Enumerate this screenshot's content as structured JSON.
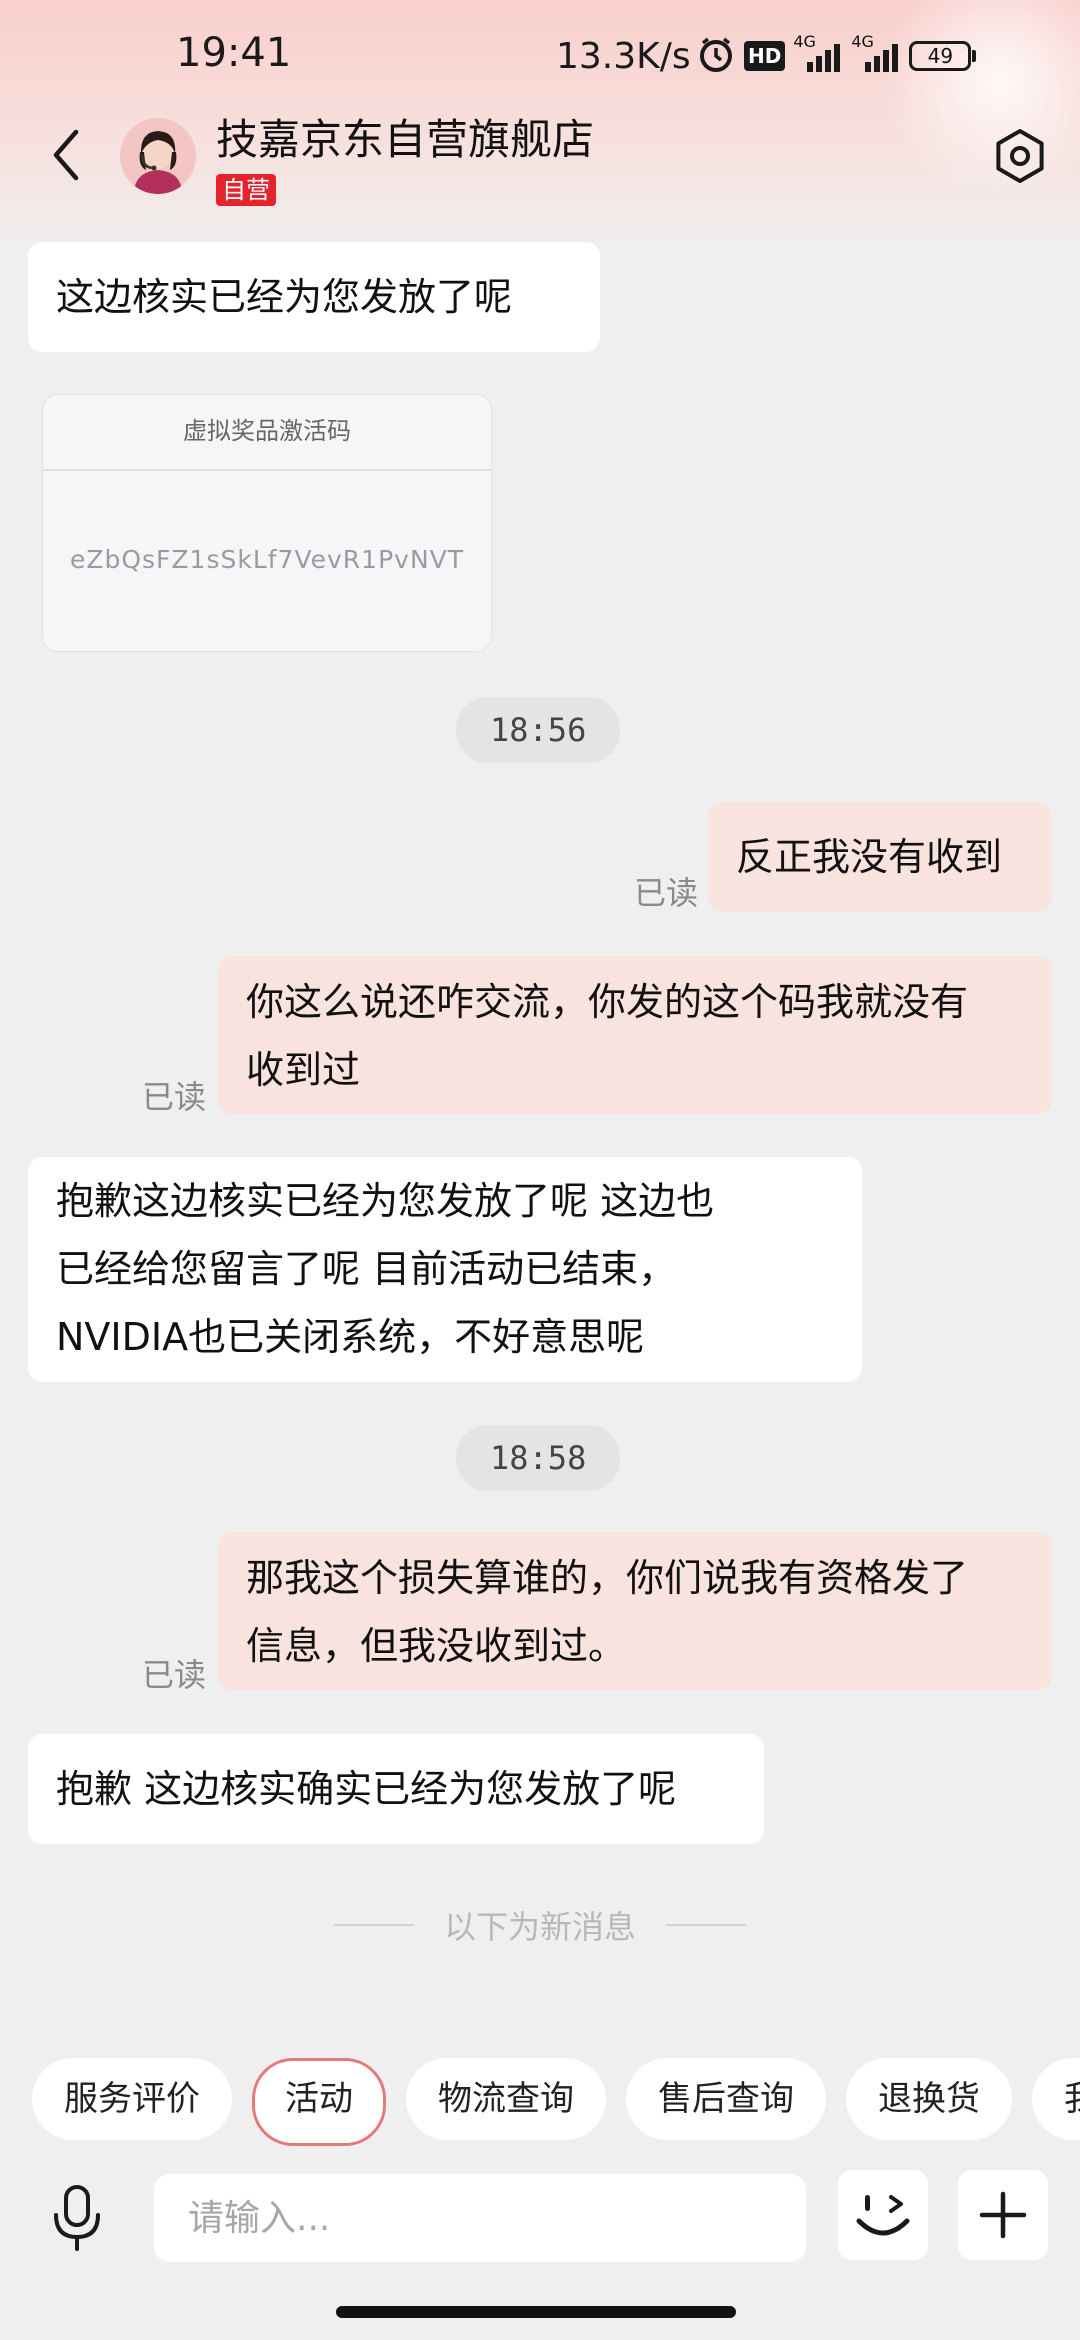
{
  "status_bar": {
    "time": "19:41",
    "net_speed": "13.3K/s",
    "battery": "49",
    "network_a": "4G",
    "network_b": "4G",
    "hd_badge": "HD",
    "icons": [
      "alarm-icon",
      "hd-icon",
      "signal-icon",
      "signal-icon",
      "battery-icon"
    ]
  },
  "header": {
    "store_name": "技嘉京东自营旗舰店",
    "tag": "自营",
    "icons": [
      "back-icon",
      "avatar",
      "settings-icon"
    ]
  },
  "messages": [
    {
      "side": "left",
      "text": "这边核实已经为您发放了呢"
    },
    {
      "side": "left",
      "type": "image",
      "card_title": "虚拟奖品激活码",
      "code": "eZbQsFZ1sSkLf7VevR1PvNVT"
    },
    {
      "type": "time",
      "text": "18:56"
    },
    {
      "side": "right",
      "text": "反正我没有收到",
      "read": "已读"
    },
    {
      "side": "right",
      "lines": [
        "你这么说还咋交流，你发的这个码我就没有",
        "收到过"
      ],
      "read": "已读"
    },
    {
      "side": "left",
      "lines": [
        "抱歉这边核实已经为您发放了呢  这边也",
        "已经给您留言了呢  目前活动已结束，",
        "NVIDIA也已关闭系统，不好意思呢"
      ]
    },
    {
      "type": "time",
      "text": "18:58"
    },
    {
      "side": "right",
      "lines": [
        "那我这个损失算谁的，你们说我有资格发了",
        "信息，但我没收到过。"
      ],
      "read": "已读"
    },
    {
      "side": "left",
      "text": "抱歉  这边核实确实已经为您发放了呢"
    }
  ],
  "new_message_divider": "以下为新消息",
  "quick_actions": [
    "服务评价",
    "活动",
    "物流查询",
    "售后查询",
    "退换货",
    "我"
  ],
  "active_quick_action": "活动",
  "input": {
    "placeholder": "请输入..."
  },
  "colors": {
    "accent_red": "#e4232d",
    "bubble_right": "#f9e3de",
    "bubble_left": "#ffffff",
    "background": "#efefef"
  }
}
